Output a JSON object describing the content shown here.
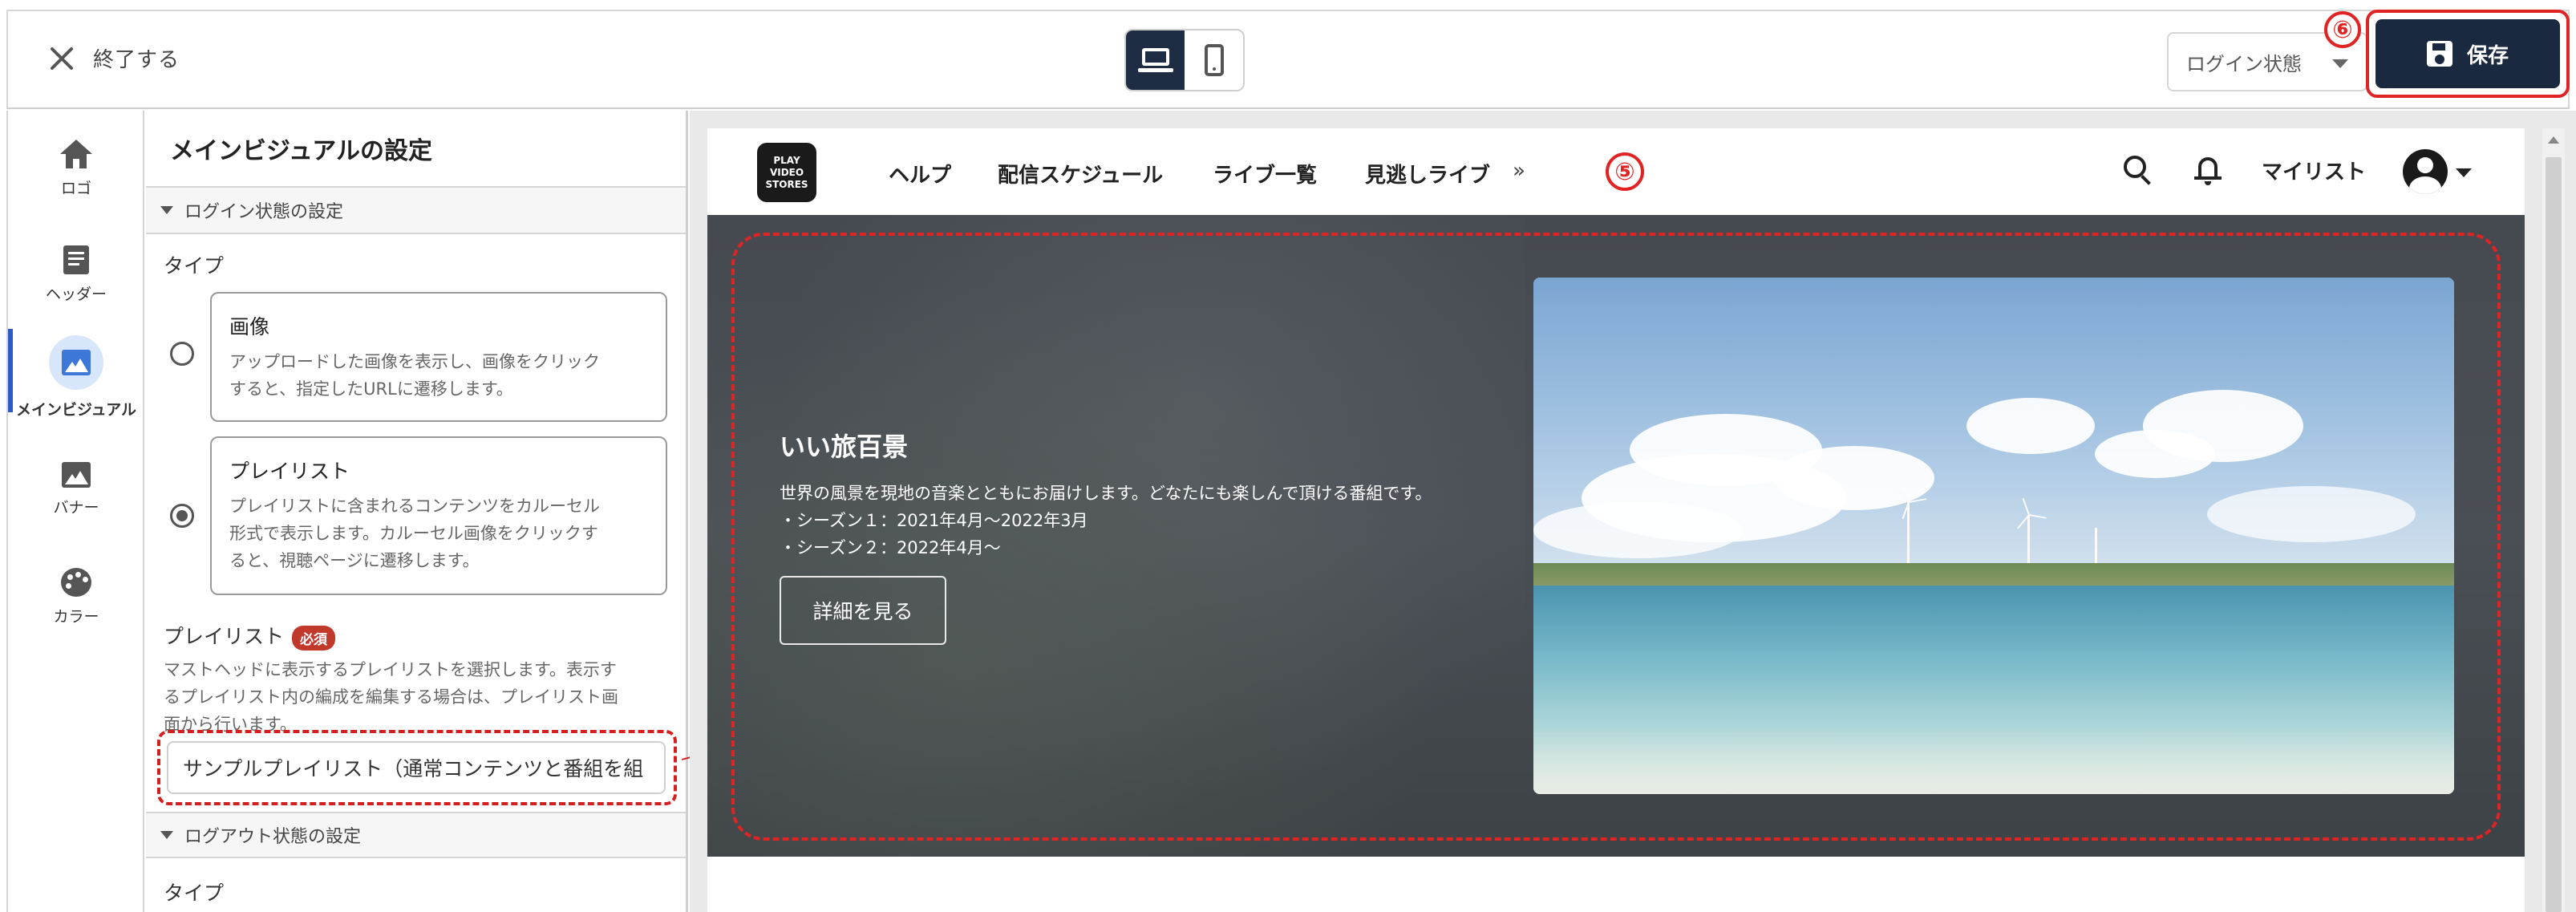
{
  "topbar": {
    "exit_label": "終了する",
    "device_modes": [
      "desktop",
      "mobile"
    ],
    "active_device": "desktop",
    "state_select_value": "ログイン状態",
    "save_label": "保存",
    "annotation_save": "⑥"
  },
  "rail": {
    "items": [
      {
        "label": "ロゴ",
        "icon": "home-icon"
      },
      {
        "label": "ヘッダー",
        "icon": "document-icon"
      },
      {
        "label": "メインビジュアル",
        "icon": "image-icon",
        "active": true
      },
      {
        "label": "バナー",
        "icon": "image-icon"
      },
      {
        "label": "カラー",
        "icon": "palette-icon"
      }
    ],
    "accent_color": "#2f5ac8"
  },
  "panel": {
    "title": "メインビジュアルの設定",
    "login_section": "ログイン状態の設定",
    "type_label": "タイプ",
    "options": [
      {
        "title": "画像",
        "desc1": "アップロードした画像を表示し、画像をクリック",
        "desc2": "すると、指定したURLに遷移します。",
        "selected": false
      },
      {
        "title": "プレイリスト",
        "desc1": "プレイリストに含まれるコンテンツをカルーセル",
        "desc2": "形式で表示します。カルーセル画像をクリックす",
        "desc3": "ると、視聴ページに遷移します。",
        "selected": true
      }
    ],
    "playlist_label": "プレイリスト",
    "required_badge": "必須",
    "playlist_help1": "マストヘッドに表示するプレイリストを選択します。表示す",
    "playlist_help2": "るプレイリスト内の編成を編集する場合は、プレイリスト画",
    "playlist_help3": "面から行います。",
    "playlist_value": "サンプルプレイリスト（通常コンテンツと番組を組",
    "logout_section": "ログアウト状態の設定",
    "type_label2": "タイプ"
  },
  "preview": {
    "logo_lines": [
      "PLAY",
      "VIDEO",
      "STORES"
    ],
    "nav": [
      "ヘルプ",
      "配信スケジュール",
      "ライブ一覧",
      "見逃しライブ"
    ],
    "more": "»",
    "annotation_hero": "⑤",
    "mylist": "マイリスト",
    "hero": {
      "title": "いい旅百景",
      "line1": "世界の風景を現地の音楽とともにお届けします。どなたにも楽しんで頂ける番組です。",
      "line2": "・シーズン１：2021年4月～2022年3月",
      "line3": "・シーズン２：2022年4月～",
      "button": "詳細を見る"
    }
  }
}
